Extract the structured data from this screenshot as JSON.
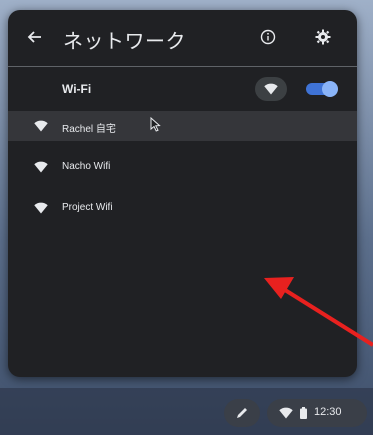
{
  "panel": {
    "title": "ネットワーク",
    "back_icon": "arrow-left-icon",
    "info_icon": "info-icon",
    "settings_icon": "gear-icon"
  },
  "wifi": {
    "label": "Wi-Fi",
    "enabled": true,
    "icon": "wifi-icon"
  },
  "networks": [
    {
      "name": "Rachel 自宅",
      "icon": "wifi-icon",
      "hovered": true
    },
    {
      "name": "Nacho Wifi",
      "icon": "wifi-icon",
      "hovered": false
    },
    {
      "name": "Project Wifi",
      "icon": "wifi-icon",
      "hovered": false
    }
  ],
  "shelf": {
    "pen_icon": "stylus-icon",
    "status_wifi_icon": "wifi-icon",
    "battery_icon": "battery-icon",
    "time": "12:30"
  },
  "colors": {
    "panel_bg": "#202124",
    "text": "#e8eaed",
    "toggle_on": "#8ab4f8",
    "annotation_arrow": "#e8211f"
  }
}
